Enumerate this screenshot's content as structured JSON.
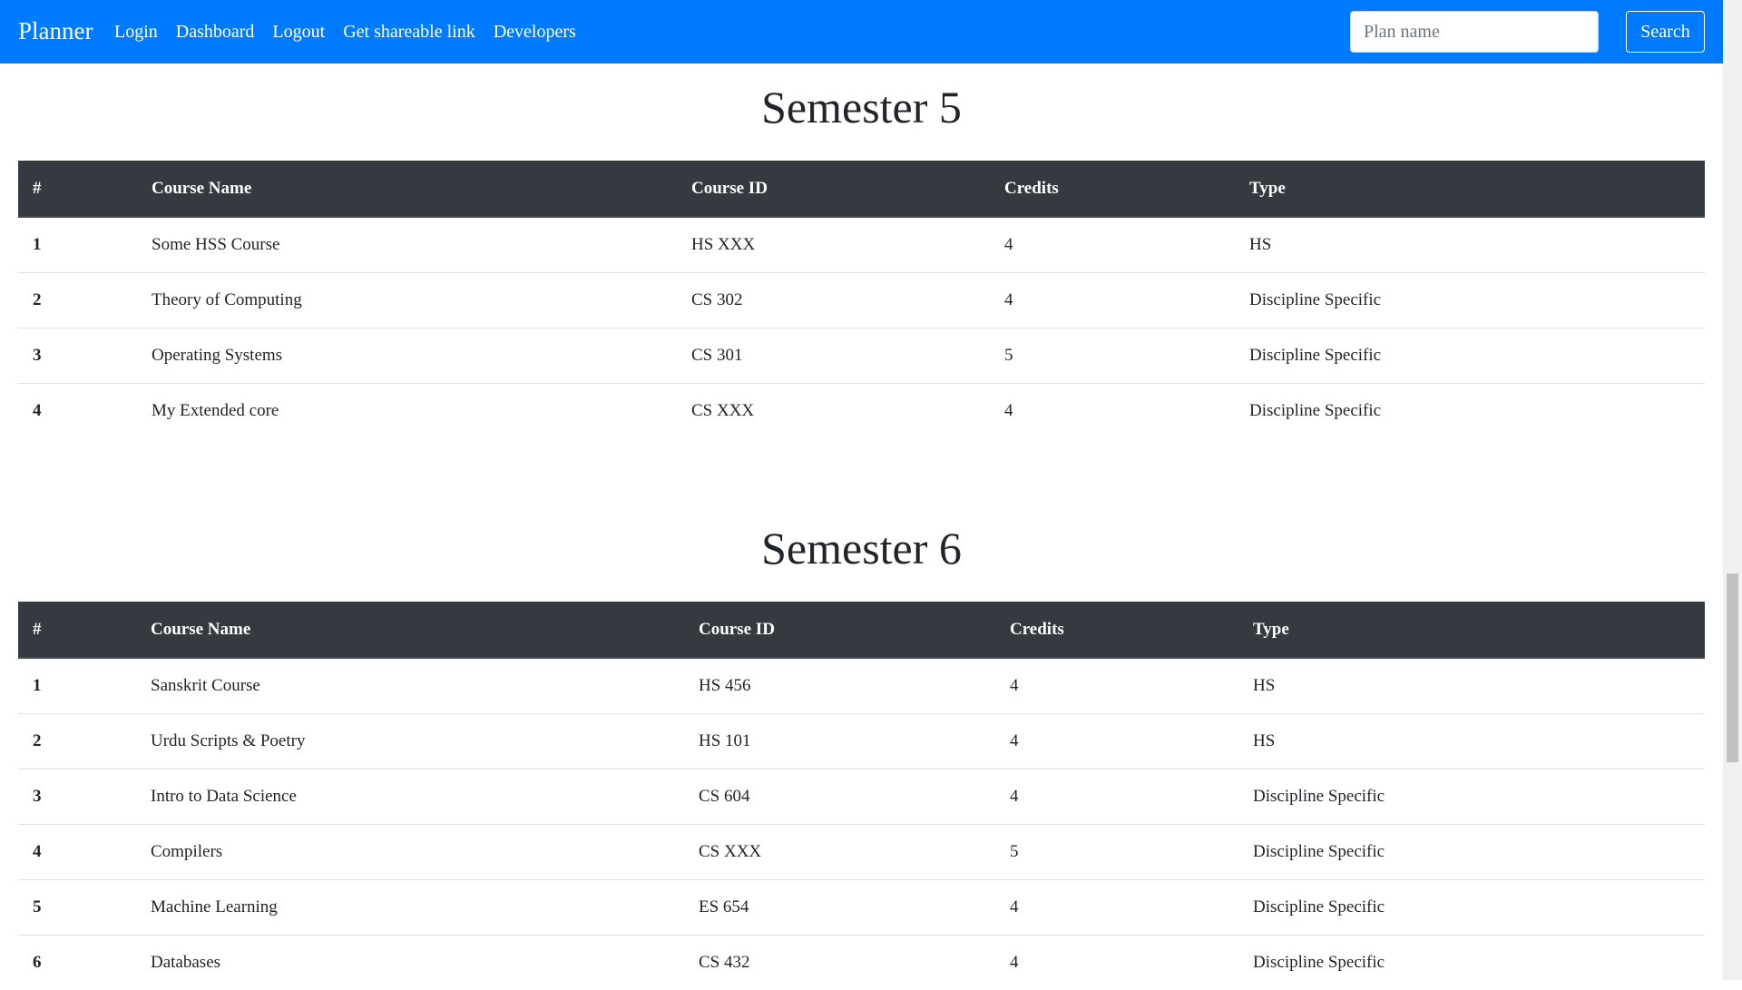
{
  "navbar": {
    "brand": "Planner",
    "links": [
      "Login",
      "Dashboard",
      "Logout",
      "Get shareable link",
      "Developers"
    ],
    "search_placeholder": "Plan name",
    "search_button": "Search",
    "accent_color": "#007bff"
  },
  "table_header_color": "#343a40",
  "columns": [
    "#",
    "Course Name",
    "Course ID",
    "Credits",
    "Type"
  ],
  "semesters": [
    {
      "title": "Semester 5",
      "rows": [
        {
          "num": "1",
          "name": "Some HSS Course",
          "id": "HS XXX",
          "credits": "4",
          "type": "HS"
        },
        {
          "num": "2",
          "name": "Theory of Computing",
          "id": "CS 302",
          "credits": "4",
          "type": "Discipline Specific"
        },
        {
          "num": "3",
          "name": "Operating Systems",
          "id": "CS 301",
          "credits": "5",
          "type": "Discipline Specific"
        },
        {
          "num": "4",
          "name": "My Extended core",
          "id": "CS XXX",
          "credits": "4",
          "type": "Discipline Specific"
        }
      ]
    },
    {
      "title": "Semester 6",
      "rows": [
        {
          "num": "1",
          "name": "Sanskrit Course",
          "id": "HS 456",
          "credits": "4",
          "type": "HS"
        },
        {
          "num": "2",
          "name": "Urdu Scripts & Poetry",
          "id": "HS 101",
          "credits": "4",
          "type": "HS"
        },
        {
          "num": "3",
          "name": "Intro to Data Science",
          "id": "CS 604",
          "credits": "4",
          "type": "Discipline Specific"
        },
        {
          "num": "4",
          "name": "Compilers",
          "id": "CS XXX",
          "credits": "5",
          "type": "Discipline Specific"
        },
        {
          "num": "5",
          "name": "Machine Learning",
          "id": "ES 654",
          "credits": "4",
          "type": "Discipline Specific"
        },
        {
          "num": "6",
          "name": "Databases",
          "id": "CS 432",
          "credits": "4",
          "type": "Discipline Specific"
        }
      ]
    }
  ]
}
